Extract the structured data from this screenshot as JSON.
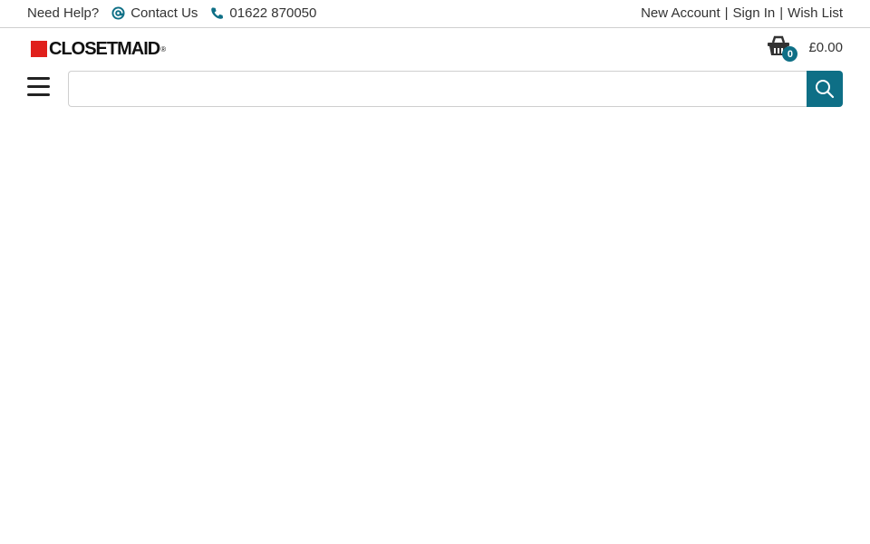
{
  "topbar": {
    "need_help": "Need Help?",
    "contact_label": "Contact Us",
    "phone": "01622 870050",
    "new_account": "New Account",
    "sign_in": "Sign In",
    "wish_list": "Wish List",
    "separator": "|"
  },
  "brand": {
    "logo_text": "CLOSETMAID",
    "registered": "®",
    "logo_color": "#e0201c"
  },
  "cart": {
    "count": "0",
    "total": "£0.00",
    "icon": "basket-icon"
  },
  "search": {
    "value": "",
    "placeholder": "",
    "icon": "search-icon"
  },
  "menu": {
    "icon": "hamburger-menu-icon"
  },
  "colors": {
    "accent": "#0e6f86",
    "text": "#333333"
  }
}
